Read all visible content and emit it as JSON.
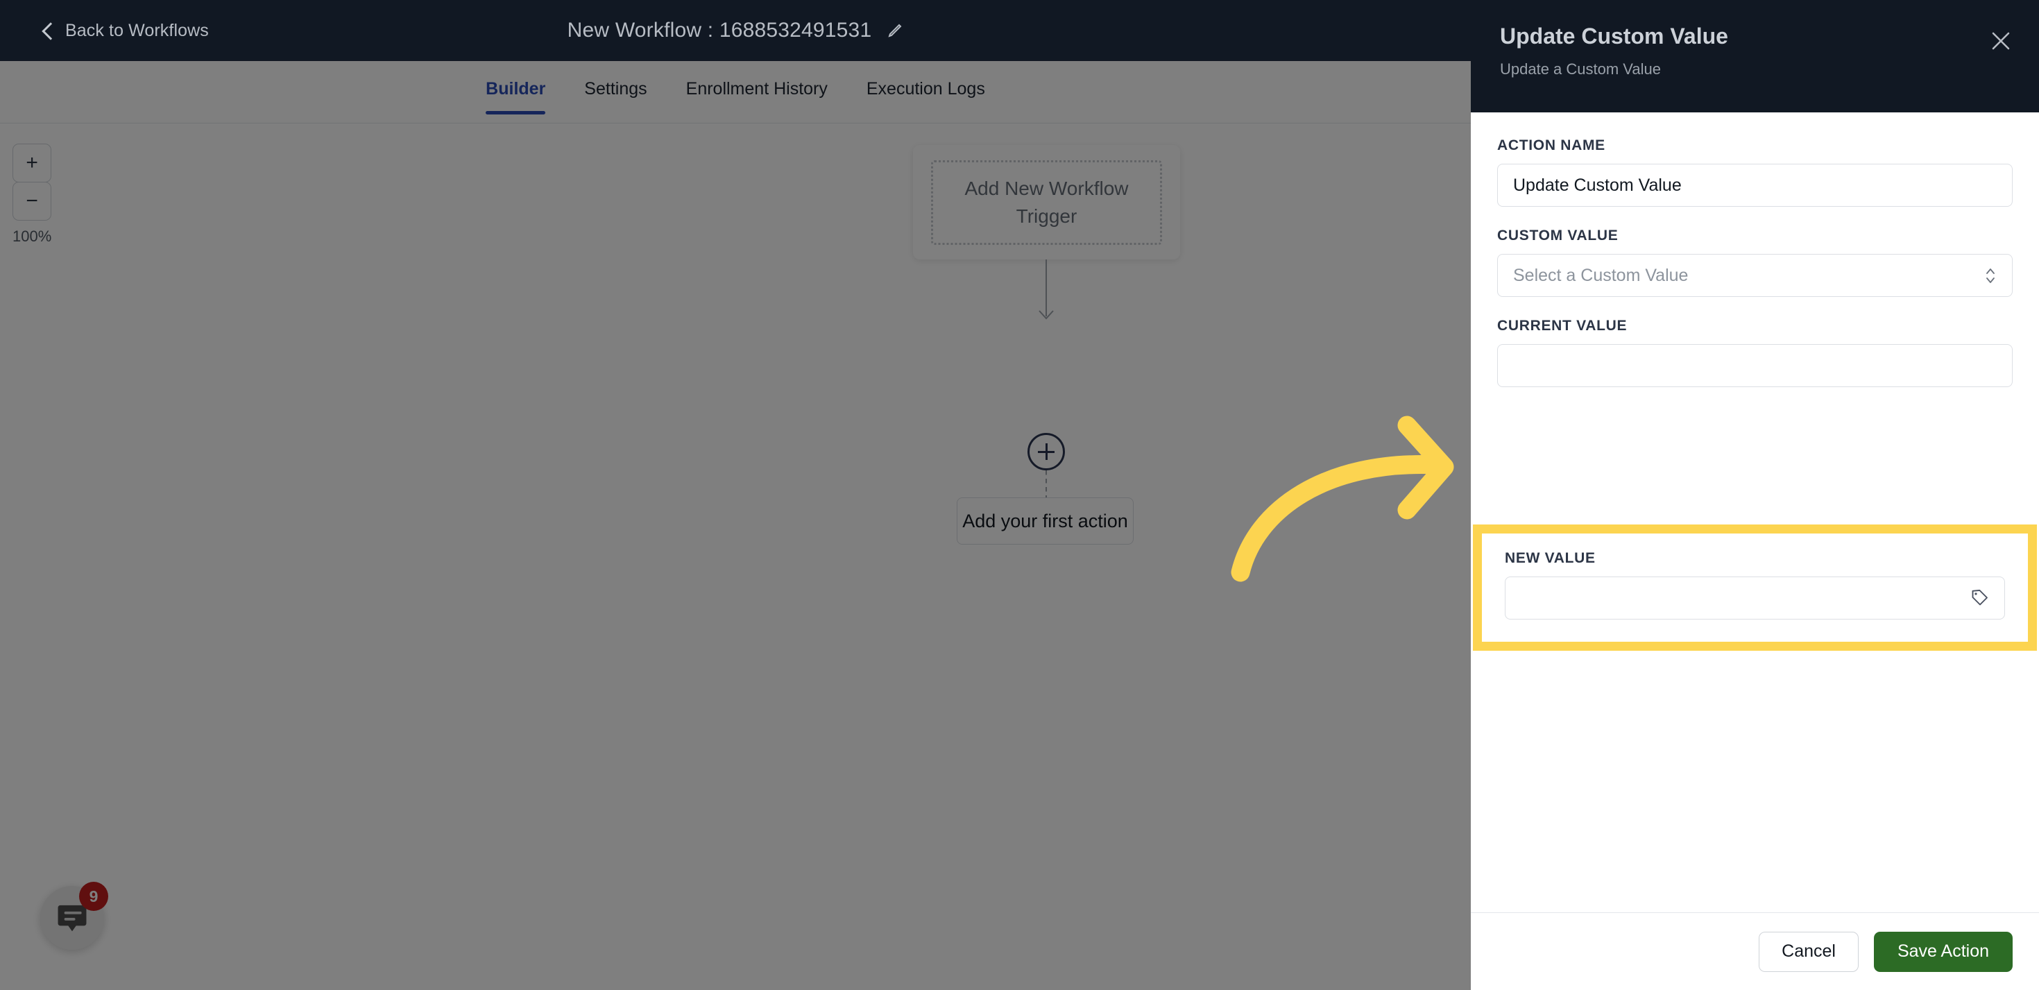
{
  "topbar": {
    "back_label": "Back to Workflows",
    "back_icon": "chevron-left-icon",
    "workflow_title": "New Workflow : 1688532491531",
    "edit_icon": "pencil-icon"
  },
  "tabs": [
    {
      "label": "Builder",
      "active": true
    },
    {
      "label": "Settings",
      "active": false
    },
    {
      "label": "Enrollment History",
      "active": false
    },
    {
      "label": "Execution Logs",
      "active": false
    }
  ],
  "canvas": {
    "zoom": {
      "zoom_in_label": "+",
      "zoom_out_label": "−",
      "level": "100%"
    },
    "trigger_card_label": "Add New Workflow Trigger",
    "add_action_node_icon": "plus-circle-icon",
    "first_action_label": "Add your first action",
    "chat_widget": {
      "icon": "chat-bubble-icon",
      "badge_count": "9"
    }
  },
  "panel": {
    "title": "Update Custom Value",
    "subtitle": "Update a Custom Value",
    "close_icon": "close-icon",
    "fields": {
      "action_name": {
        "label": "ACTION NAME",
        "value": "Update Custom Value",
        "placeholder": "Action Name"
      },
      "custom_value": {
        "label": "CUSTOM VALUE",
        "value": "",
        "placeholder": "Select a Custom Value",
        "caret_icon": "chevron-up-down-icon"
      },
      "current_value": {
        "label": "CURRENT VALUE",
        "value": "",
        "placeholder": ""
      },
      "new_value": {
        "label": "NEW VALUE",
        "value": "",
        "placeholder": "",
        "tag_icon": "tag-icon",
        "highlighted": true
      }
    },
    "footer": {
      "cancel_label": "Cancel",
      "save_label": "Save Action"
    }
  },
  "annotation": {
    "arrow_icon": "curved-arrow-right-icon",
    "arrow_color": "#fcd450"
  },
  "colors": {
    "topbar_bg": "#111823",
    "accent_blue": "#2a4bb5",
    "save_green": "#2c6b25",
    "highlight_yellow": "#fcd450",
    "badge_red": "#c01f1f",
    "overlay": "rgba(0,0,0,0.50)"
  }
}
